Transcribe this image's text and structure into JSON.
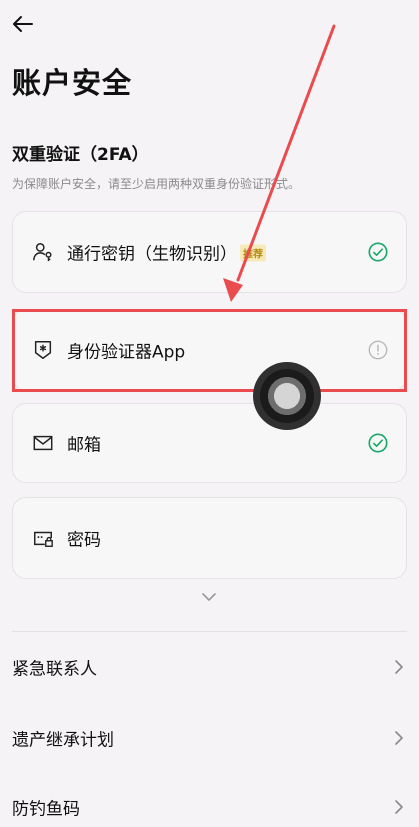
{
  "header": {
    "title": "账户安全"
  },
  "twofa": {
    "title": "双重验证（2FA）",
    "description": "为保障账户安全，请至少启用两种双重身份验证形式。",
    "methods": [
      {
        "label": "通行密钥（生物识别）",
        "badge": "推荐",
        "icon": "passkey-user-icon",
        "status": "enabled"
      },
      {
        "label": "身份验证器App",
        "icon": "authenticator-shield-icon",
        "status": "warning"
      },
      {
        "label": "邮箱",
        "icon": "mail-icon",
        "status": "enabled"
      },
      {
        "label": "密码",
        "icon": "password-lock-icon",
        "status": "none"
      }
    ]
  },
  "settings": [
    {
      "label": "紧急联系人"
    },
    {
      "label": "遗产继承计划"
    },
    {
      "label": "防钓鱼码"
    }
  ],
  "colors": {
    "accent_green": "#17a96b",
    "annotation_red": "#ea4b4e",
    "badge_bg": "#f8eab8",
    "badge_text": "#b48b12"
  }
}
